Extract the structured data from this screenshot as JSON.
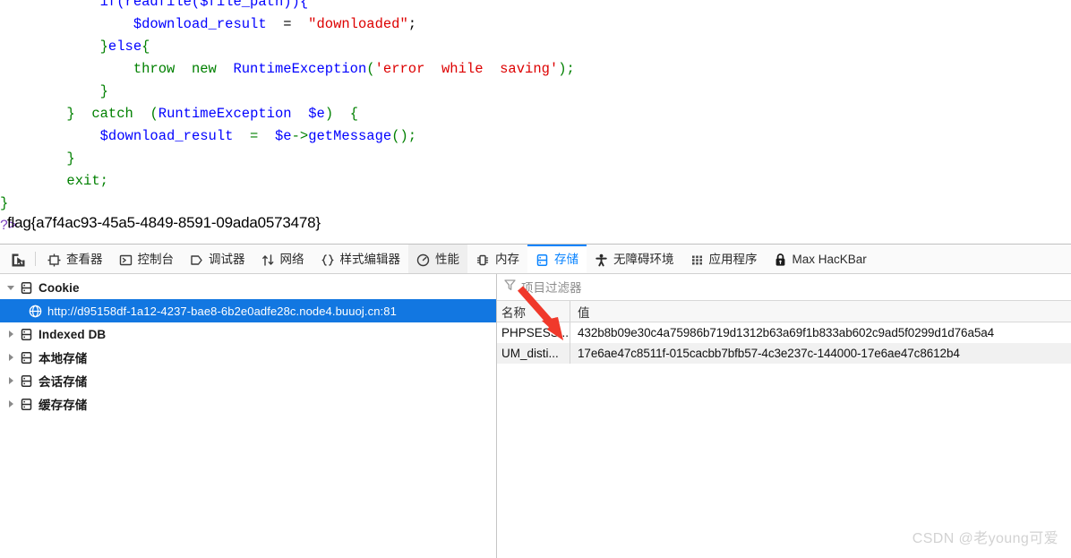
{
  "page": {
    "code_lines": [
      [
        {
          "t": "            if(readfile($file_path)){",
          "c": "blue"
        }
      ],
      [
        {
          "t": "                ",
          "c": "black"
        },
        {
          "t": "$download_result",
          "c": "blue"
        },
        {
          "t": "  =  ",
          "c": "black"
        },
        {
          "t": "\"downloaded\"",
          "c": "red"
        },
        {
          "t": ";",
          "c": "black"
        }
      ],
      [
        {
          "t": "            }",
          "c": "green"
        },
        {
          "t": "else",
          "c": "blue"
        },
        {
          "t": "{",
          "c": "green"
        }
      ],
      [
        {
          "t": "                ",
          "c": "black"
        },
        {
          "t": "throw  new  ",
          "c": "green"
        },
        {
          "t": "RuntimeException",
          "c": "blue"
        },
        {
          "t": "(",
          "c": "green"
        },
        {
          "t": "'error  while  saving'",
          "c": "red"
        },
        {
          "t": ");",
          "c": "green"
        }
      ],
      [
        {
          "t": "            }",
          "c": "green"
        }
      ],
      [
        {
          "t": "        }  ",
          "c": "green"
        },
        {
          "t": "catch  ",
          "c": "green"
        },
        {
          "t": "(",
          "c": "green"
        },
        {
          "t": "RuntimeException  ",
          "c": "blue"
        },
        {
          "t": "$e",
          "c": "blue"
        },
        {
          "t": ")  {",
          "c": "green"
        }
      ],
      [
        {
          "t": "            ",
          "c": "black"
        },
        {
          "t": "$download_result",
          "c": "blue"
        },
        {
          "t": "  =  ",
          "c": "green"
        },
        {
          "t": "$e",
          "c": "blue"
        },
        {
          "t": "->",
          "c": "green"
        },
        {
          "t": "getMessage",
          "c": "blue"
        },
        {
          "t": "();",
          "c": "green"
        }
      ],
      [
        {
          "t": "        }",
          "c": "green"
        }
      ],
      [
        {
          "t": "        exit;",
          "c": "green"
        }
      ],
      [
        {
          "t": "}",
          "c": "green"
        }
      ],
      [
        {
          "t": "?>",
          "c": "purple"
        }
      ]
    ],
    "flag": "flag{a7f4ac93-45a5-4849-8591-09ada0573478}"
  },
  "devtools": {
    "toolbar": {
      "picker_label": "",
      "tabs": [
        {
          "id": "inspector",
          "label": "查看器",
          "icon": "inspector-icon",
          "active": false
        },
        {
          "id": "console",
          "label": "控制台",
          "icon": "console-icon",
          "active": false
        },
        {
          "id": "debugger",
          "label": "调试器",
          "icon": "debugger-icon",
          "active": false
        },
        {
          "id": "network",
          "label": "网络",
          "icon": "network-icon",
          "active": false
        },
        {
          "id": "style-editor",
          "label": "样式编辑器",
          "icon": "style-editor-icon",
          "active": false
        },
        {
          "id": "performance",
          "label": "性能",
          "icon": "performance-icon",
          "active": false
        },
        {
          "id": "memory",
          "label": "内存",
          "icon": "memory-icon",
          "active": false
        },
        {
          "id": "storage",
          "label": "存储",
          "icon": "storage-icon",
          "active": true
        },
        {
          "id": "accessibility",
          "label": "无障碍环境",
          "icon": "accessibility-icon",
          "active": false
        },
        {
          "id": "application",
          "label": "应用程序",
          "icon": "application-icon",
          "active": false
        },
        {
          "id": "hackbar",
          "label": "Max HacKBar",
          "icon": "lock-icon",
          "active": false
        }
      ],
      "active_tab_color": "#0a84ff"
    },
    "sidebar": {
      "items": [
        {
          "label": "Cookie",
          "expanded": true,
          "selected": false,
          "level": 0
        },
        {
          "label": "http://d95158df-1a12-4237-bae8-6b2e0adfe28c.node4.buuoj.cn:81",
          "expanded": false,
          "selected": true,
          "level": 1
        },
        {
          "label": "Indexed DB",
          "expanded": false,
          "selected": false,
          "level": 0
        },
        {
          "label": "本地存储",
          "expanded": false,
          "selected": false,
          "level": 0
        },
        {
          "label": "会话存储",
          "expanded": false,
          "selected": false,
          "level": 0
        },
        {
          "label": "缓存存储",
          "expanded": false,
          "selected": false,
          "level": 0
        }
      ],
      "selection_color": "#1277e1"
    },
    "main": {
      "filter_placeholder": "项目过滤器",
      "table": {
        "columns": [
          "名称",
          "值"
        ],
        "rows": [
          {
            "name": "PHPSESS...",
            "value": "432b8b09e30c4a75986b719d1312b63a69f1b833ab602c9ad5f0299d1d76a5a4"
          },
          {
            "name": "UM_disti...",
            "value": "17e6ae47c8511f-015cacbb7bfb57-4c3e237c-144000-17e6ae47c8612b4"
          }
        ]
      }
    },
    "annotation": {
      "arrow_color": "#f0392b"
    }
  },
  "watermark": {
    "text": "CSDN @老young可爱"
  }
}
